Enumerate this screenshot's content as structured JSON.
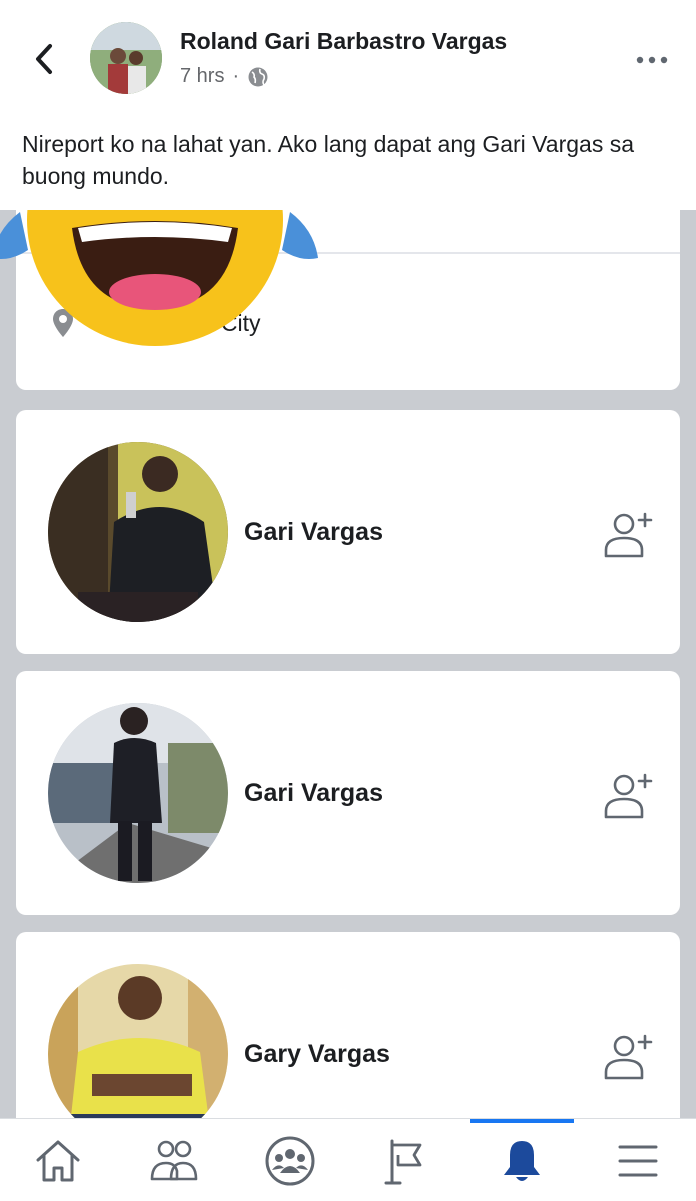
{
  "header": {
    "author": "Roland Gari Barbastro Vargas",
    "time": "7 hrs",
    "separator": "·"
  },
  "post": {
    "text": "Nireport ko na lahat yan. Ako lang dapat ang Gari Vargas sa buong mundo."
  },
  "screenshot": {
    "location_text": "Muntinlupa City",
    "results": [
      {
        "name": "Gari Vargas",
        "action_icon": "add-friend-icon"
      },
      {
        "name": "Gari Vargas",
        "action_icon": "add-friend-icon"
      },
      {
        "name": "Gary Vargas",
        "action_icon": "add-friend-icon"
      }
    ]
  },
  "tabbar": {
    "tabs": [
      "home-icon",
      "friends-icon",
      "groups-icon",
      "pages-flag-icon",
      "notifications-bell-icon",
      "menu-icon"
    ],
    "active_tab": "notifications-bell-icon"
  },
  "colors": {
    "accent": "#1877f2",
    "secondary_text": "#65676b",
    "screenshot_bg": "#c9ccd1"
  }
}
